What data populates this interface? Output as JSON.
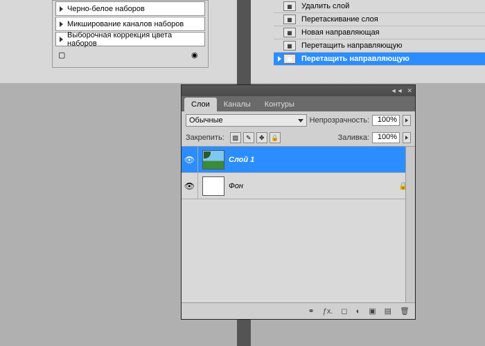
{
  "adjustments": {
    "items": [
      {
        "label": "Черно-белое наборов"
      },
      {
        "label": "Микширование каналов наборов"
      },
      {
        "label": "Выборочная коррекция цвета наборов"
      }
    ]
  },
  "history": {
    "items": [
      {
        "label": "Удалить слой",
        "selected": false,
        "current": false
      },
      {
        "label": "Перетаскивание слоя",
        "selected": false,
        "current": false
      },
      {
        "label": "Новая направляющая",
        "selected": false,
        "current": false
      },
      {
        "label": "Перетащить направляющую",
        "selected": false,
        "current": false
      },
      {
        "label": "Перетащить направляющую",
        "selected": true,
        "current": true
      }
    ]
  },
  "layers_panel": {
    "tabs": [
      {
        "label": "Слои",
        "active": true
      },
      {
        "label": "Каналы",
        "active": false
      },
      {
        "label": "Контуры",
        "active": false
      }
    ],
    "blend_mode": "Обычные",
    "opacity_label": "Непрозрачность:",
    "opacity_value": "100%",
    "lock_label": "Закрепить:",
    "fill_label": "Заливка:",
    "fill_value": "100%",
    "layers": [
      {
        "name": "Слой 1",
        "selected": true,
        "thumb": "image",
        "locked": false
      },
      {
        "name": "Фон",
        "selected": false,
        "thumb": "white",
        "locked": true
      }
    ],
    "footer_icons": [
      "link",
      "fx",
      "mask",
      "adjust",
      "group",
      "new",
      "trash"
    ]
  }
}
